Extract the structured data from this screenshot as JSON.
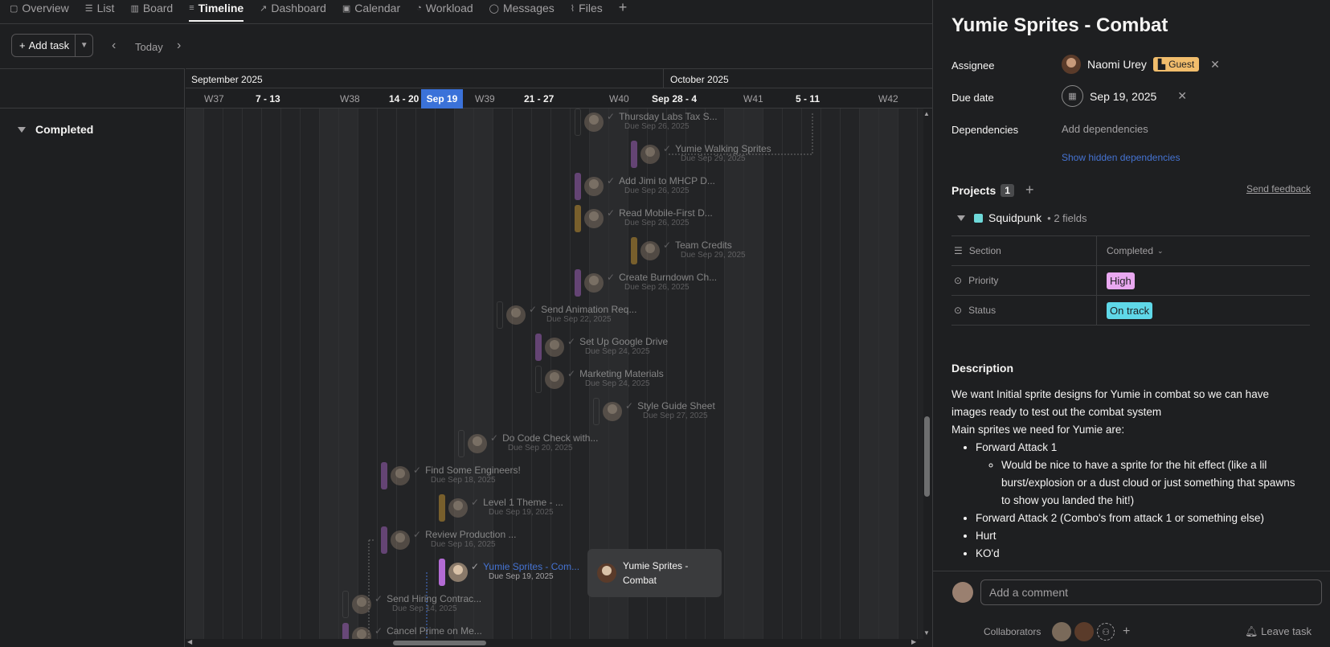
{
  "nav": {
    "tabs": [
      {
        "label": "Overview",
        "icon": "overview-icon"
      },
      {
        "label": "List",
        "icon": "list-icon"
      },
      {
        "label": "Board",
        "icon": "board-icon"
      },
      {
        "label": "Timeline",
        "icon": "timeline-icon"
      },
      {
        "label": "Dashboard",
        "icon": "dashboard-icon"
      },
      {
        "label": "Calendar",
        "icon": "calendar-icon"
      },
      {
        "label": "Workload",
        "icon": "workload-icon"
      },
      {
        "label": "Messages",
        "icon": "messages-icon"
      },
      {
        "label": "Files",
        "icon": "files-icon"
      }
    ],
    "active_tab": "Timeline"
  },
  "toolbar": {
    "add_task": "Add task",
    "today": "Today"
  },
  "section": {
    "label": "Completed"
  },
  "timeline": {
    "months": [
      "September 2025",
      "October 2025"
    ],
    "weeks": [
      "W37",
      "7 - 13",
      "W38",
      "14 - 20",
      "Sep 19",
      "W39",
      "21 - 27",
      "W40",
      "Sep 28 - 4",
      "W41",
      "5 - 11",
      "W42"
    ],
    "tasks": [
      {
        "name": "Thursday Labs Tax S...",
        "due": "Due Sep 26, 2025",
        "color": "empty"
      },
      {
        "name": "Yumie Walking Sprites",
        "due": "Due Sep 29, 2025",
        "color": "purple"
      },
      {
        "name": "Add Jimi to MHCP D...",
        "due": "Due Sep 26, 2025",
        "color": "purple"
      },
      {
        "name": "Read Mobile-First D...",
        "due": "Due Sep 26, 2025",
        "color": "yellow"
      },
      {
        "name": "Team Credits",
        "due": "Due Sep 29, 2025",
        "color": "yellow"
      },
      {
        "name": "Create Burndown Ch...",
        "due": "Due Sep 26, 2025",
        "color": "purple"
      },
      {
        "name": "Send Animation Req...",
        "due": "Due Sep 22, 2025",
        "color": "empty"
      },
      {
        "name": "Set Up Google Drive",
        "due": "Due Sep 24, 2025",
        "color": "purple"
      },
      {
        "name": "Marketing Materials",
        "due": "Due Sep 24, 2025",
        "color": "empty"
      },
      {
        "name": "Style Guide Sheet",
        "due": "Due Sep 27, 2025",
        "color": "empty"
      },
      {
        "name": "Do Code Check with...",
        "due": "Due Sep 20, 2025",
        "color": "empty"
      },
      {
        "name": "Find Some Engineers!",
        "due": "Due Sep 18, 2025",
        "color": "purple"
      },
      {
        "name": "Level 1 Theme - ...",
        "due": "Due Sep 19, 2025",
        "color": "yellow"
      },
      {
        "name": "Review Production ...",
        "due": "Due Sep 16, 2025",
        "color": "purple"
      },
      {
        "name": "Yumie Sprites - Com...",
        "due": "Due Sep 19, 2025",
        "color": "purple"
      },
      {
        "name": "Send Hiring Contrac...",
        "due": "Due Sep 14, 2025",
        "color": "empty"
      },
      {
        "name": "Cancel Prime on Me...",
        "due": "",
        "color": "purple"
      }
    ],
    "tooltip": "Yumie Sprites - Combat"
  },
  "panel": {
    "title": "Yumie Sprites - Combat",
    "assignee_label": "Assignee",
    "assignee_name": "Naomi Urey",
    "guest_badge": "Guest",
    "due_label": "Due date",
    "due_value": "Sep 19, 2025",
    "dependencies_label": "Dependencies",
    "add_dependencies": "Add dependencies",
    "show_hidden": "Show hidden dependencies",
    "projects_label": "Projects",
    "projects_count": "1",
    "send_feedback": "Send feedback",
    "project_name": "Squidpunk",
    "project_fields": "• 2 fields",
    "fields": [
      {
        "name": "Section",
        "value": "Completed"
      },
      {
        "name": "Priority",
        "value": "High"
      },
      {
        "name": "Status",
        "value": "On track"
      }
    ],
    "description_label": "Description",
    "description_intro": "We want Initial sprite designs for Yumie in combat so we can have images ready to test out the combat system",
    "description_main": "Main sprites we need for Yumie are:",
    "bullets": {
      "b1": "Forward Attack 1",
      "b1_sub": "Would be nice to have a sprite for the hit effect (like a lil burst/explosion or a dust cloud or just something that spawns to show you landed the hit!)",
      "b2": "Forward Attack 2 (Combo's from attack 1 or something else)",
      "b3": "Hurt",
      "b4": "KO'd"
    },
    "comment_placeholder": "Add a comment",
    "collaborators_label": "Collaborators",
    "leave_task": "Leave task"
  },
  "colors": {
    "accent": "#4573d2",
    "today": "#3b72d9",
    "purple": "#b36bd4",
    "yellow": "#e0a834",
    "high": "#e9a8f0",
    "on_track": "#5fd8e8",
    "guest": "#f1bd6c"
  }
}
